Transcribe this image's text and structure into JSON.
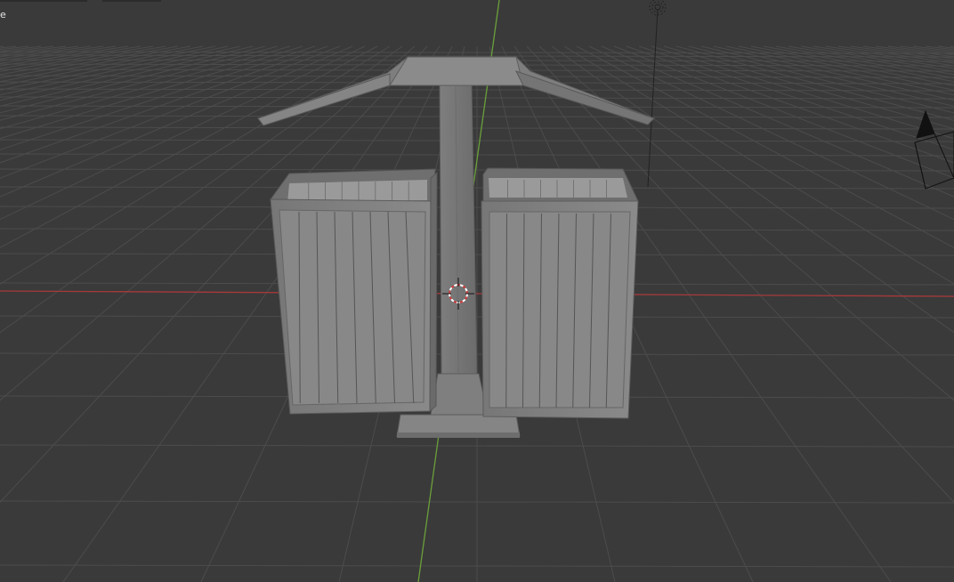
{
  "viewport": {
    "background": "#3a3a3a",
    "visible_text": "e",
    "axis_x_color": "#b33a3a",
    "axis_y_color": "#6ea33b",
    "grid_color": "#4a4a4a"
  },
  "scene": {
    "object_name_icon": "trash-bin-model",
    "camera_icon": "camera-icon",
    "light_icon": "light-icon",
    "cursor_icon": "3d-cursor-icon"
  }
}
